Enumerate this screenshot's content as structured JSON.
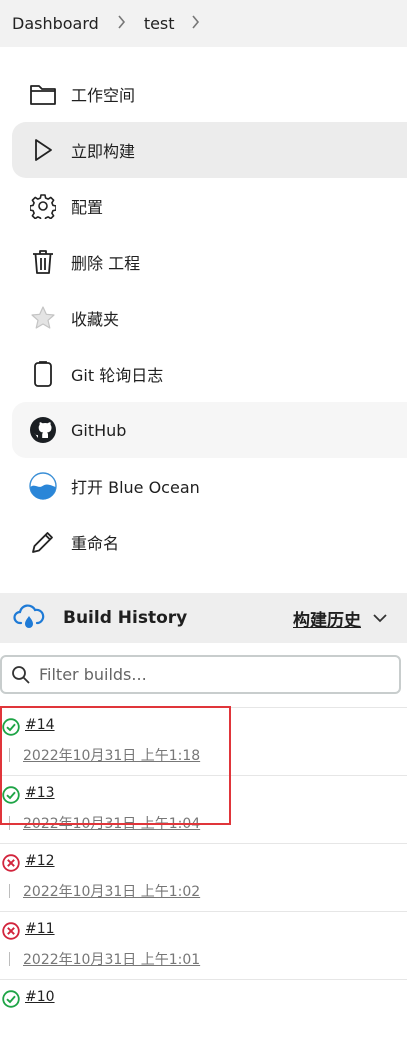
{
  "breadcrumb": {
    "root": "Dashboard",
    "job": "test"
  },
  "menu": [
    {
      "label": "工作空间",
      "icon": "folder-icon"
    },
    {
      "label": "立即构建",
      "icon": "play-icon"
    },
    {
      "label": "配置",
      "icon": "gear-icon"
    },
    {
      "label": "删除 工程",
      "icon": "trash-icon"
    },
    {
      "label": "收藏夹",
      "icon": "star-icon"
    },
    {
      "label": "Git 轮询日志",
      "icon": "clipboard-icon"
    },
    {
      "label": "GitHub",
      "icon": "github-icon"
    },
    {
      "label": "打开 Blue Ocean",
      "icon": "blue-ocean-icon"
    },
    {
      "label": "重命名",
      "icon": "pencil-icon"
    }
  ],
  "build_history": {
    "title": "Build History",
    "trend_label": "构建历史",
    "filter_placeholder": "Filter builds...",
    "builds": [
      {
        "number": "#14",
        "date": "2022年10月31日 上午1:18",
        "status": "success"
      },
      {
        "number": "#13",
        "date": "2022年10月31日 上午1:04",
        "status": "success"
      },
      {
        "number": "#12",
        "date": "2022年10月31日 上午1:02",
        "status": "failure"
      },
      {
        "number": "#11",
        "date": "2022年10月31日 上午1:01",
        "status": "failure"
      },
      {
        "number": "#10",
        "date": "",
        "status": "success"
      }
    ]
  },
  "colors": {
    "success": "#1ea446",
    "failure": "#d2243c",
    "highlight": "#e0353a",
    "cloud": "#1e7ad6"
  }
}
